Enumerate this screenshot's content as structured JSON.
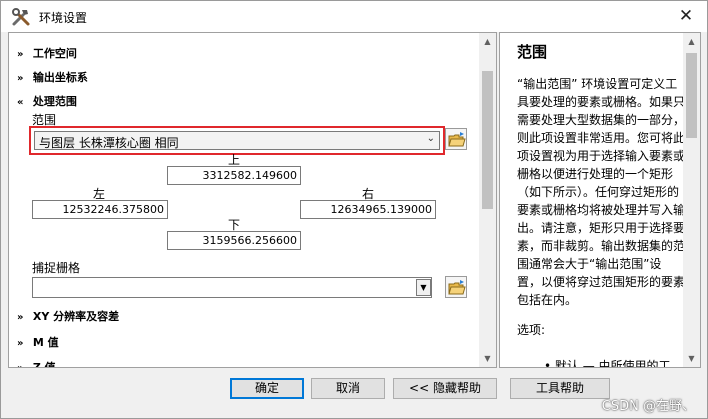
{
  "window": {
    "title": "环境设置",
    "close_glyph": "✕"
  },
  "left_panel": {
    "sections": {
      "workspace": {
        "label": "工作空间",
        "chevron": "»"
      },
      "output_coords": {
        "label": "输出坐标系",
        "chevron": "»"
      },
      "processing_extent": {
        "label": "处理范围",
        "chevron": "«"
      },
      "xy_resolution": {
        "label": "XY 分辨率及容差",
        "chevron": "»"
      },
      "m_values": {
        "label": "M 值",
        "chevron": "»"
      },
      "z_values": {
        "label": "Z 值",
        "chevron": "»"
      }
    },
    "extent": {
      "label": "范围",
      "selected": "与图层 长株潭核心圈 相同",
      "top_label": "上",
      "top_value": "3312582.149600",
      "left_label": "左",
      "left_value": "12532246.375800",
      "right_label": "右",
      "right_value": "12634965.139000",
      "bottom_label": "下",
      "bottom_value": "3159566.256600"
    },
    "snap_raster": {
      "label": "捕捉栅格",
      "value": ""
    }
  },
  "help": {
    "title": "范围",
    "body": "“输出范围” 环境设置可定义工具要处理的要素或栅格。如果只需要处理大型数据集的一部分，则此项设置非常适用。您可将此项设置视为用于选择输入要素或栅格以便进行处理的一个矩形（如下所示）。任何穿过矩形的要素或栅格均将被处理并写入输出。请注意，矩形只用于选择要素，而非裁剪。输出数据集的范围通常会大于“输出范围”设置，以便将穿过范围矩形的要素包括在内。",
    "options_label": "选项:",
    "cut_text": "• 默认 — 由所使用的工"
  },
  "buttons": {
    "ok": "确定",
    "cancel": "取消",
    "hide_help": "<< 隐藏帮助",
    "tool_help": "工具帮助"
  },
  "watermark": "CSDN @在野、",
  "icons": {
    "title": "tools-icon",
    "folder": "open-folder-icon"
  },
  "colors": {
    "highlight_border": "#e0282c",
    "ok_border": "#0078d7"
  }
}
